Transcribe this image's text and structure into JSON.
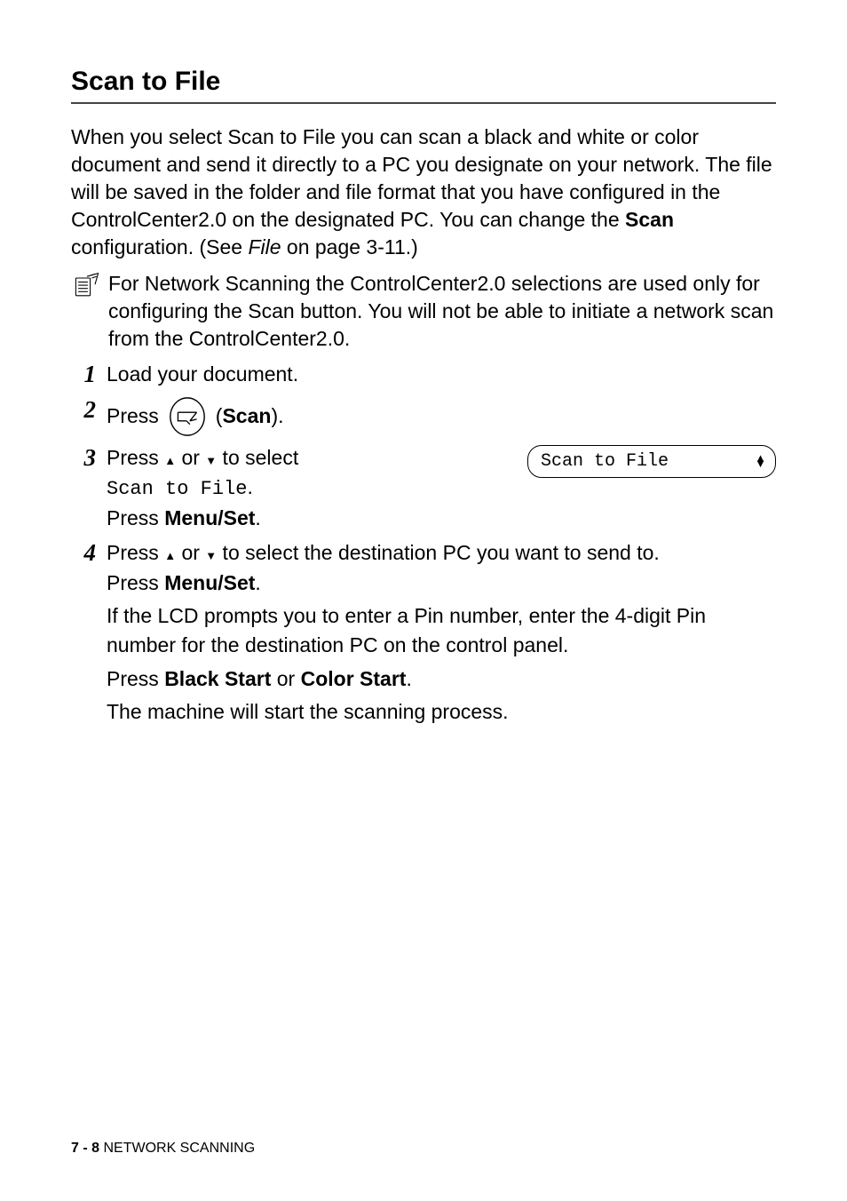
{
  "section": {
    "title": "Scan to File",
    "intro_prefix": "When you select Scan to File you can scan a black and white or color document and send it directly to a PC you designate on your network. The file will be saved in the folder and file format that you have configured in the ControlCenter2.0 on the designated PC. You can change the ",
    "intro_bold": "Scan",
    "intro_mid": " configuration. (See ",
    "intro_italic": "File",
    "intro_suffix": " on page 3-11.)"
  },
  "note": {
    "text": "For Network Scanning the ControlCenter2.0 selections are used only for configuring the Scan button. You will not be able to initiate a network scan from the ControlCenter2.0."
  },
  "steps": {
    "s1": {
      "num": "1",
      "text": "Load your document."
    },
    "s2": {
      "num": "2",
      "press": "Press",
      "open_paren": " (",
      "scan": "Scan",
      "close_paren": ")."
    },
    "s3": {
      "num": "3",
      "line1a": "Press ",
      "line1b": " or ",
      "line1c": " to select ",
      "mono": "Scan to File",
      "period": ".",
      "line2a": "Press ",
      "line2b": "Menu/Set",
      "line2c": ".",
      "lcd": "Scan to File"
    },
    "s4": {
      "num": "4",
      "line1a": "Press ",
      "line1b": " or ",
      "line1c": " to select the destination PC you want to send to.",
      "line2a": "Press ",
      "line2b": "Menu/Set",
      "line2c": ".",
      "para1": "If the LCD prompts you to enter a Pin number, enter the 4-digit Pin number for the destination PC on the control panel.",
      "line3a": "Press ",
      "line3b": "Black Start",
      "line3c": " or ",
      "line3d": "Color Start",
      "line3e": ".",
      "para2": "The machine will start the scanning process."
    }
  },
  "glyphs": {
    "up": "▲",
    "down": "▼"
  },
  "footer": {
    "page": "7 - 8",
    "chapter": "   NETWORK SCANNING"
  }
}
